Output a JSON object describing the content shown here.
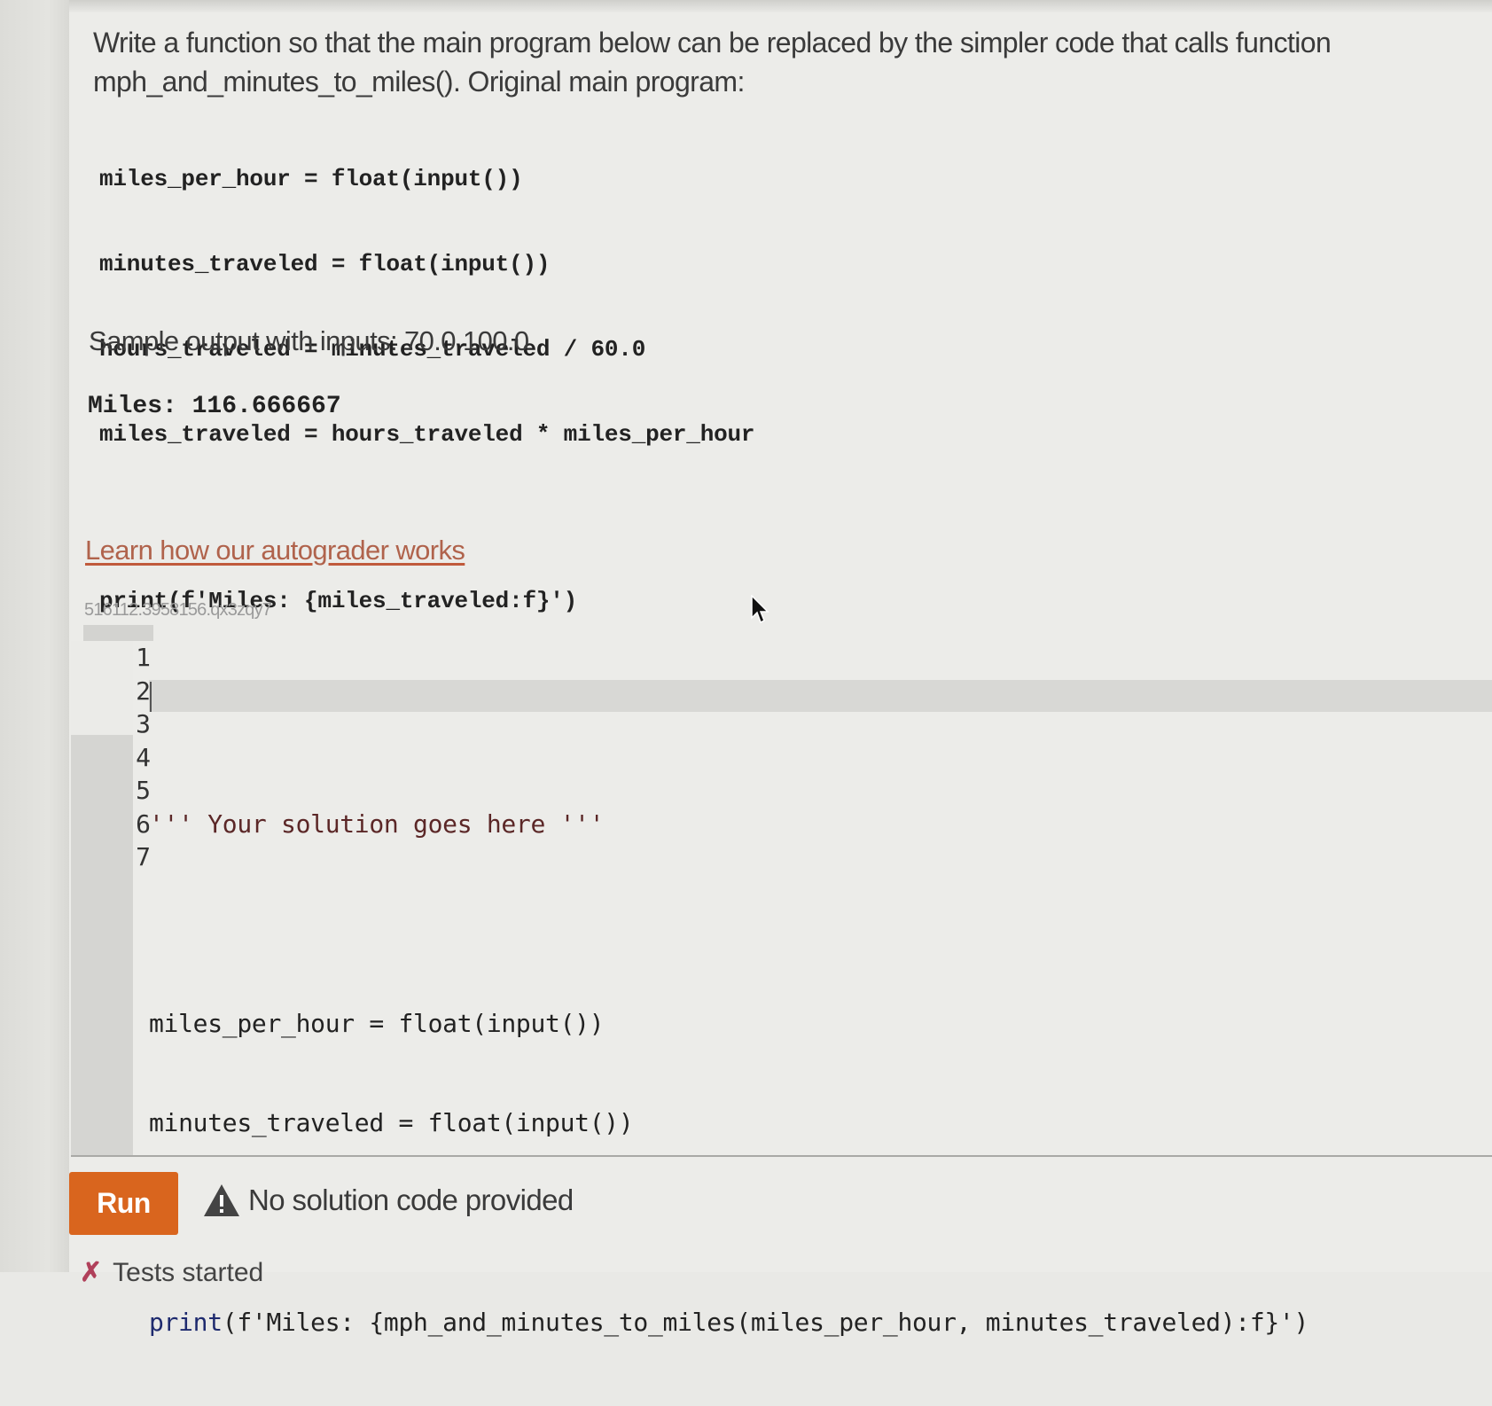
{
  "prompt": {
    "line1": "Write a function so that the main program below can be replaced by the simpler code that calls function",
    "line2": "mph_and_minutes_to_miles(). Original main program:"
  },
  "original_program": {
    "lines": [
      "miles_per_hour = float(input())",
      "minutes_traveled = float(input())",
      "hours_traveled = minutes_traveled / 60.0",
      "miles_traveled = hours_traveled * miles_per_hour",
      "",
      "print(f'Miles: {miles_traveled:f}')"
    ]
  },
  "sample": {
    "label": "Sample output with inputs: 70.0 100.0",
    "output": "Miles: 116.666667"
  },
  "learn_link": "Learn how our autograder works",
  "challenge_id": "516112.3958156.qx3zqy7",
  "editor": {
    "line_numbers": [
      "1",
      "2",
      "3",
      "4",
      "5",
      "6",
      "7"
    ],
    "lines": [
      {
        "text": ""
      },
      {
        "text": "''' Your solution goes here '''"
      },
      {
        "text": ""
      },
      {
        "text": "miles_per_hour = float(input())"
      },
      {
        "text": "minutes_traveled = float(input())"
      },
      {
        "text": ""
      },
      {
        "prefix": "print",
        "rest": "(f'Miles: {mph_and_minutes_to_miles(miles_per_hour, minutes_traveled):f}')"
      }
    ],
    "active_line": 2
  },
  "run_button": "Run",
  "status": {
    "icon": "warning-icon",
    "message": "No solution code provided"
  },
  "tests": {
    "icon": "x-icon",
    "label": "Tests started"
  },
  "colors": {
    "run_button": "#d9651e",
    "link": "#b0634c",
    "background": "#ecece9"
  }
}
